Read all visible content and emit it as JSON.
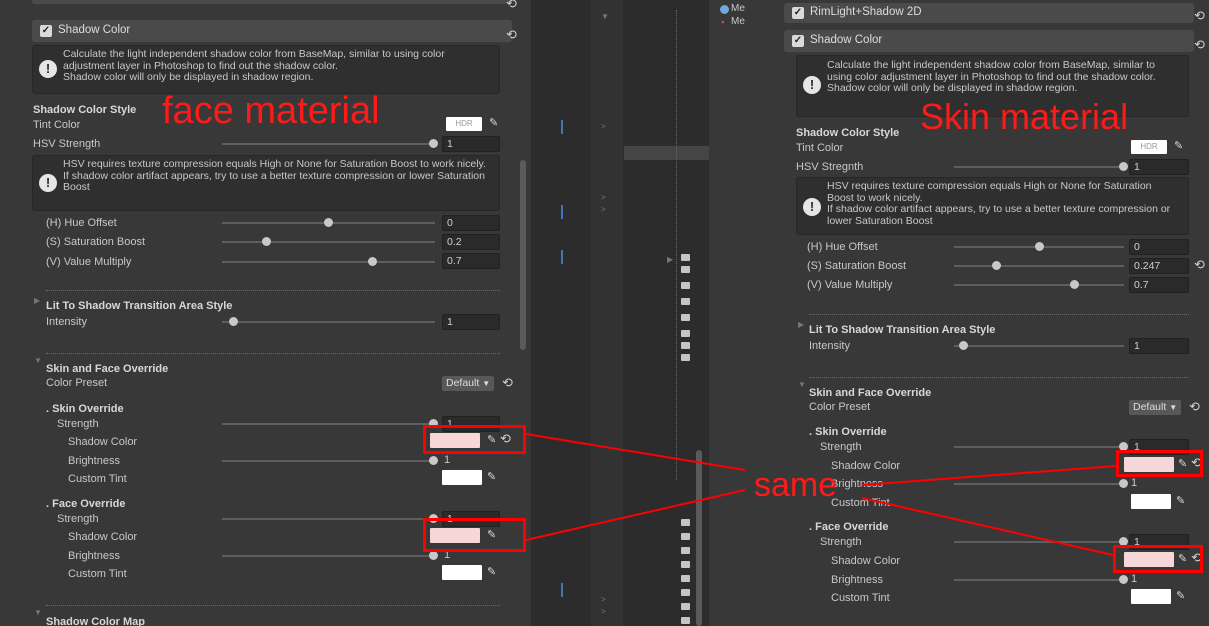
{
  "left": {
    "header": "Shadow Color",
    "help1": "Calculate the light independent shadow color from BaseMap, similar to using color adjustment layer in Photoshop to find out the shadow color.\nShadow color will only be displayed in shadow region.",
    "style_title": "Shadow Color Style",
    "tint_label": "Tint Color",
    "hdr": "HDR",
    "hsv_label": "HSV Strength",
    "hsv_value": "1",
    "help2": "HSV requires texture compression equals High or None for Saturation Boost to work nicely.\nIf shadow color artifact appears, try to use a better texture compression or lower Saturation Boost",
    "hue_label": "(H) Hue Offset",
    "hue_value": "0",
    "sat_label": "(S) Saturation Boost",
    "sat_value": "0.2",
    "val_label": "(V) Value Multiply",
    "val_value": "0.7",
    "lit_title": "Lit To Shadow Transition Area Style",
    "intensity_label": "Intensity",
    "intensity_value": "1",
    "sfo_title": "Skin and Face Override",
    "preset_label": "Color Preset",
    "preset_value": "Default",
    "skin_override": ". Skin Override",
    "strength_label": "Strength",
    "strength_value": "1",
    "shadow_color_label": "Shadow Color",
    "brightness_label": "Brightness",
    "brightness_value": "1",
    "custom_tint_label": "Custom Tint",
    "face_override": ". Face Override",
    "face_strength_value": "1",
    "face_brightness_value": "1",
    "map_title": "Shadow Color Map"
  },
  "right": {
    "top_item": "RimLight+Shadow 2D",
    "header": "Shadow Color",
    "help1": "Calculate the light independent shadow color from BaseMap, similar to using color adjustment layer in Photoshop to find out the shadow color.\nShadow color will only be displayed in shadow region.",
    "style_title": "Shadow Color Style",
    "tint_label": "Tint Color",
    "hdr": "HDR",
    "hsv_label": "HSV Stregnth",
    "hsv_value": "1",
    "help2": "HSV requires texture compression equals High or None for Saturation Boost to work nicely.\nIf shadow color artifact appears, try to use a better texture compression or lower Saturation Boost",
    "hue_label": "(H) Hue Offset",
    "hue_value": "0",
    "sat_label": "(S) Saturation Boost",
    "sat_value": "0.247",
    "val_label": "(V) Value Multiply",
    "val_value": "0.7",
    "lit_title": "Lit To Shadow Transition Area Style",
    "intensity_label": "Intensity",
    "intensity_value": "1",
    "sfo_title": "Skin and Face Override",
    "preset_label": "Color Preset",
    "preset_value": "Default",
    "skin_override": ". Skin Override",
    "strength_label": "Strength",
    "strength_value": "1",
    "shadow_color_label": "Shadow Color",
    "brightness_label": "Brightness",
    "brightness_value": "1",
    "custom_tint_label": "Custom Tint",
    "face_override": ". Face Override",
    "face_strength_value": "1",
    "face_brightness_value": "1"
  },
  "middle": {
    "me1": "Me",
    "me2": "Me"
  },
  "annotations": {
    "face": "face material",
    "skin": "Skin material",
    "same": "same"
  },
  "colors": {
    "annotation_red": "#ff0000",
    "shadow_swatch": "#f6d6d6",
    "panel_bg": "#383838"
  }
}
